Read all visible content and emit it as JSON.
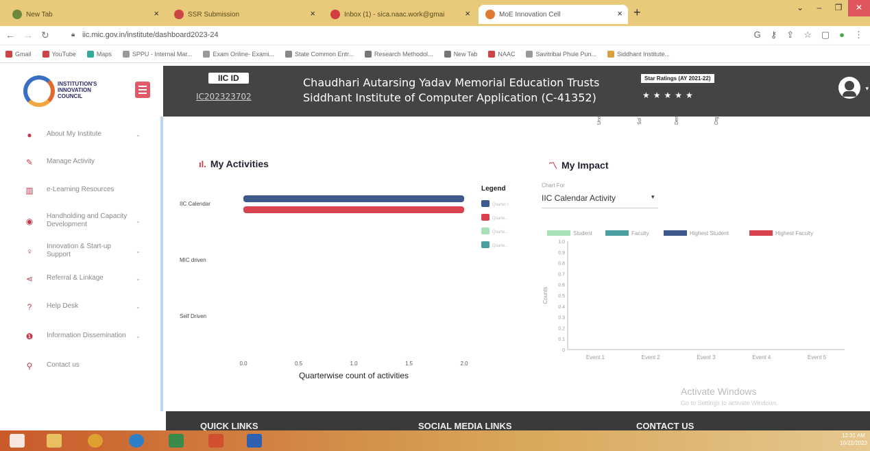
{
  "browser": {
    "tabs": [
      {
        "label": "New Tab"
      },
      {
        "label": "SSR Submission"
      },
      {
        "label": "Inbox (1) - sica.naac.work@gmai"
      },
      {
        "label": "MoE Innovation Cell"
      }
    ],
    "url": "iic.mic.gov.in/institute/dashboard2023-24",
    "bookmarks": [
      "Gmail",
      "YouTube",
      "Maps",
      "SPPU - Internal Mar...",
      "Exam Online- Exami...",
      "State Common Entr...",
      "Research Methodol...",
      "New Tab",
      "NAAC",
      "Savitribai Phule Pun...",
      "Siddhant Institute..."
    ]
  },
  "header": {
    "logo_text": "INSTITUTION'S INNOVATION COUNCIL",
    "iic_label": "IIC ID",
    "iic_id": "IC202323702",
    "org_line1": "Chaudhari Autarsing Yadav Memorial Education Trusts",
    "org_line2": "Siddhant Institute of Computer Application (C-41352)",
    "star_label": "Star Ratings (AY 2021-22)",
    "stars": "★★★★★"
  },
  "sidebar": {
    "items": [
      {
        "label": "About My Institute",
        "icon": "user-icon"
      },
      {
        "label": "Manage Activity",
        "icon": "edit-icon"
      },
      {
        "label": "e-Learning Resources",
        "icon": "book-icon"
      },
      {
        "label": "Handholding and Capacity Development",
        "icon": "eye-icon"
      },
      {
        "label": "Innovation & Start-up Support",
        "icon": "bulb-icon"
      },
      {
        "label": "Referral & Linkage",
        "icon": "share-icon"
      },
      {
        "label": "Help Desk",
        "icon": "question-icon"
      },
      {
        "label": "Information Dissemination",
        "icon": "info-icon"
      },
      {
        "label": "Contact us",
        "icon": "location-icon"
      }
    ]
  },
  "top_fragments": [
    "Undi",
    "Sol",
    "Dem",
    "Orgi"
  ],
  "activities": {
    "title": "My Activities",
    "legend_title": "Legend"
  },
  "impact": {
    "title": "My Impact",
    "chart_for_label": "Chart For",
    "chart_for_value": "IIC Calendar Activity"
  },
  "chart_data": [
    {
      "type": "bar",
      "orientation": "horizontal",
      "categories": [
        "IIC Calendar",
        "MIC driven",
        "Self Driven"
      ],
      "series": [
        {
          "name": "Quarter I",
          "color": "#3e5a8c",
          "values": [
            2,
            0,
            0
          ]
        },
        {
          "name": "Quarter II",
          "color": "#d9434f",
          "values": [
            2,
            0,
            0
          ]
        },
        {
          "name": "Quarter III",
          "color": "#a8e0b8",
          "values": [
            0,
            0,
            0
          ]
        },
        {
          "name": "Quarter IV",
          "color": "#4aa0a0",
          "values": [
            0,
            0,
            0
          ]
        }
      ],
      "legend_labels": [
        "Quarter I",
        "Quarte...",
        "Quarte...",
        "Quarte..."
      ],
      "xlabel": "Quarterwise count of activities",
      "xlim": [
        0,
        2
      ],
      "xticks": [
        "0.0",
        "0.5",
        "1.0",
        "1.5",
        "2.0"
      ]
    },
    {
      "type": "bar",
      "categories": [
        "Event 1",
        "Event 2",
        "Event 3",
        "Event 4",
        "Event 5"
      ],
      "series": [
        {
          "name": "Student",
          "color": "#a8e0b8",
          "values": [
            0,
            0,
            0,
            0,
            0
          ]
        },
        {
          "name": "Faculty",
          "color": "#4aa0a0",
          "values": [
            0,
            0,
            0,
            0,
            0
          ]
        },
        {
          "name": "Highest Student",
          "color": "#3e5a8c",
          "values": [
            0,
            0,
            0,
            0,
            0
          ]
        },
        {
          "name": "Highest Faculty",
          "color": "#d9434f",
          "values": [
            0,
            0,
            0,
            0,
            0
          ]
        }
      ],
      "ylabel": "Counts",
      "ylim": [
        0,
        1
      ],
      "yticks": [
        "0",
        "0.1",
        "0.2",
        "0.3",
        "0.4",
        "0.5",
        "0.6",
        "0.7",
        "0.8",
        "0.9",
        "1.0"
      ]
    }
  ],
  "footer": {
    "quick_links": "QUICK LINKS",
    "social": "SOCIAL MEDIA LINKS",
    "contact": "CONTACT US"
  },
  "watermark": {
    "line1": "Activate Windows",
    "line2": "Go to Settings to activate Windows."
  },
  "taskbar": {
    "time": "12:31 AM",
    "date": "10/22/2023"
  }
}
